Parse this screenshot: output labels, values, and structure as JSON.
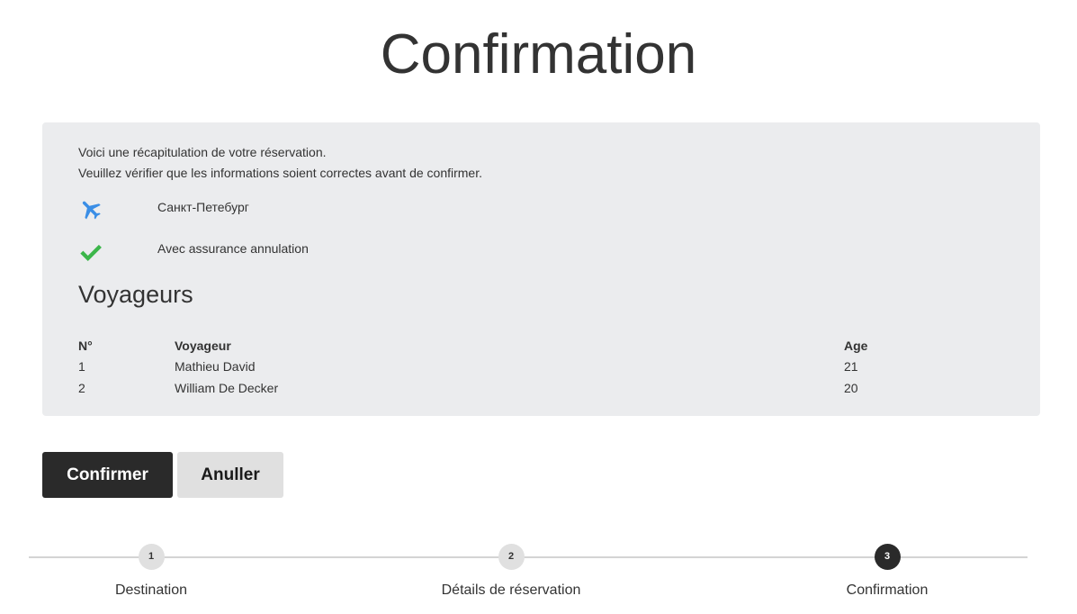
{
  "page": {
    "title": "Confirmation"
  },
  "summary": {
    "intro_line1": "Voici une récapitulation de votre réservation.",
    "intro_line2": "Veuillez vérifier que les informations soient correctes avant de confirmer.",
    "destination": {
      "icon": "plane-icon",
      "icon_color": "#3a8ee6",
      "label": "Санкт-Петебург"
    },
    "insurance": {
      "icon": "check-icon",
      "icon_color": "#3cb64a",
      "label": "Avec assurance annulation"
    }
  },
  "travellers": {
    "title": "Voyageurs",
    "headers": {
      "num": "N°",
      "name": "Voyageur",
      "age": "Age"
    },
    "rows": [
      {
        "num": "1",
        "name": "Mathieu David",
        "age": "21"
      },
      {
        "num": "2",
        "name": "William De Decker",
        "age": "20"
      }
    ]
  },
  "actions": {
    "confirm_label": "Confirmer",
    "cancel_label": "Anuller"
  },
  "stepper": {
    "steps": [
      {
        "number": "1",
        "label": "Destination",
        "active": false
      },
      {
        "number": "2",
        "label": "Détails de réservation",
        "active": false
      },
      {
        "number": "3",
        "label": "Confirmation",
        "active": true
      }
    ]
  },
  "colors": {
    "panel_bg": "#ebecee",
    "primary_button": "#2a2a2a",
    "secondary_button": "#e0e0e0"
  }
}
